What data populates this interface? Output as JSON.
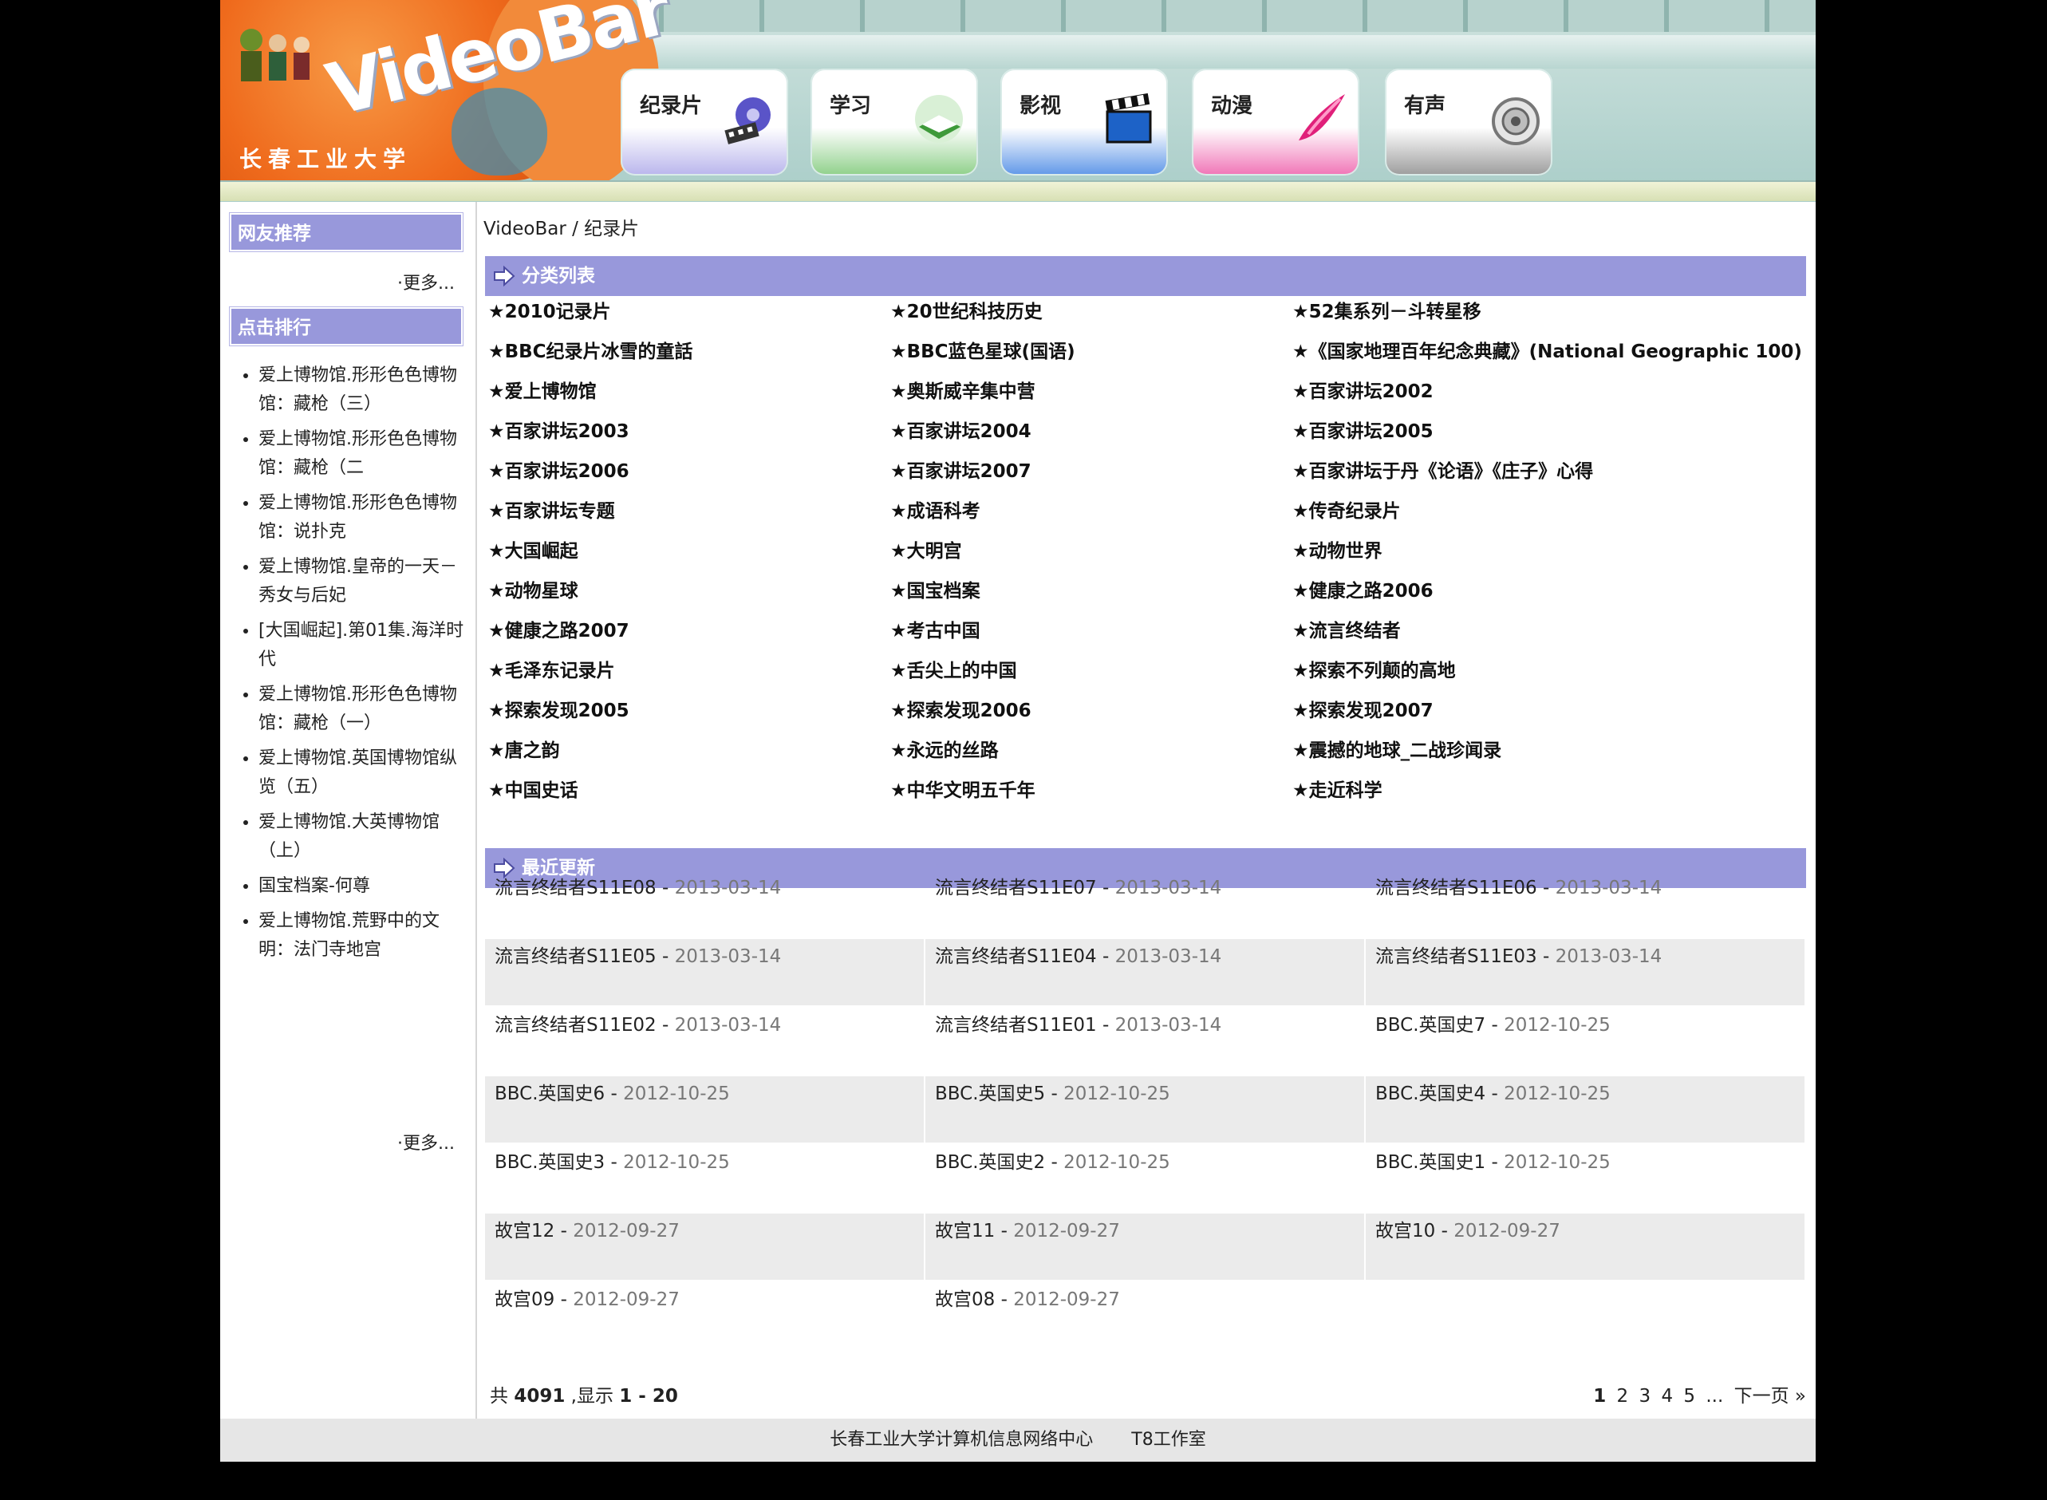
{
  "header": {
    "logo_title": "VideoBar",
    "logo_school": "长春工业大学",
    "nav": [
      {
        "label": "纪录片",
        "icon": "film-reel-icon"
      },
      {
        "label": "学习",
        "icon": "book-icon"
      },
      {
        "label": "影视",
        "icon": "clapperboard-icon"
      },
      {
        "label": "动漫",
        "icon": "brush-stroke-icon"
      },
      {
        "label": "有声",
        "icon": "speaker-icon"
      }
    ]
  },
  "sidebar": {
    "recommend_title": "网友推荐",
    "recommend_more": "·更多...",
    "rank_title": "点击排行",
    "rank_items": [
      "爱上博物馆.形形色色博物馆：藏枪（三）",
      "爱上博物馆.形形色色博物馆：藏枪（二",
      "爱上博物馆.形形色色博物馆：说扑克",
      "爱上博物馆.皇帝的一天－秀女与后妃",
      "[大国崛起].第01集.海洋时代",
      "爱上博物馆.形形色色博物馆：藏枪（一）",
      "爱上博物馆.英国博物馆纵览（五）",
      "爱上博物馆.大英博物馆（上）",
      "国宝档案-何尊",
      "爱上博物馆.荒野中的文明：法门寺地宫"
    ],
    "rank_more": "·更多..."
  },
  "main": {
    "breadcrumb_root": "VideoBar",
    "breadcrumb_sep": " / ",
    "breadcrumb_current": "纪录片",
    "category_title": "分类列表",
    "categories": [
      "★2010记录片",
      "★20世纪科技历史",
      "★52集系列－斗转星移",
      "★BBC纪录片冰雪的童話",
      "★BBC蓝色星球(国语)",
      "★《国家地理百年纪念典藏》(National Geographic 100)",
      "★爱上博物馆",
      "★奥斯威辛集中营",
      "★百家讲坛2002",
      "★百家讲坛2003",
      "★百家讲坛2004",
      "★百家讲坛2005",
      "★百家讲坛2006",
      "★百家讲坛2007",
      "★百家讲坛于丹《论语》《庄子》心得",
      "★百家讲坛专题",
      "★成语科考",
      "★传奇纪录片",
      "★大国崛起",
      "★大明宫",
      "★动物世界",
      "★动物星球",
      "★国宝档案",
      "★健康之路2006",
      "★健康之路2007",
      "★考古中国",
      "★流言终结者",
      "★毛泽东记录片",
      "★舌尖上的中国",
      "★探索不列颠的高地",
      "★探索发现2005",
      "★探索发现2006",
      "★探索发现2007",
      "★唐之韵",
      "★永远的丝路",
      "★震撼的地球_二战珍闻录",
      "★中国史话",
      "★中华文明五千年",
      "★走近科学"
    ],
    "updates_title": "最近更新",
    "updates": [
      {
        "title": "流言终结者S11E08",
        "date": "2013-03-14"
      },
      {
        "title": "流言终结者S11E07",
        "date": "2013-03-14"
      },
      {
        "title": "流言终结者S11E06",
        "date": "2013-03-14"
      },
      {
        "title": "流言终结者S11E05",
        "date": "2013-03-14"
      },
      {
        "title": "流言终结者S11E04",
        "date": "2013-03-14"
      },
      {
        "title": "流言终结者S11E03",
        "date": "2013-03-14"
      },
      {
        "title": "流言终结者S11E02",
        "date": "2013-03-14"
      },
      {
        "title": "流言终结者S11E01",
        "date": "2013-03-14"
      },
      {
        "title": "BBC.英国史7",
        "date": "2012-10-25"
      },
      {
        "title": "BBC.英国史6",
        "date": "2012-10-25"
      },
      {
        "title": "BBC.英国史5",
        "date": "2012-10-25"
      },
      {
        "title": "BBC.英国史4",
        "date": "2012-10-25"
      },
      {
        "title": "BBC.英国史3",
        "date": "2012-10-25"
      },
      {
        "title": "BBC.英国史2",
        "date": "2012-10-25"
      },
      {
        "title": "BBC.英国史1",
        "date": "2012-10-25"
      },
      {
        "title": "故宫12",
        "date": "2012-09-27"
      },
      {
        "title": "故宫11",
        "date": "2012-09-27"
      },
      {
        "title": "故宫10",
        "date": "2012-09-27"
      },
      {
        "title": "故宫09",
        "date": "2012-09-27"
      },
      {
        "title": "故宫08",
        "date": "2012-09-27"
      }
    ],
    "pager": {
      "total_prefix": "共 ",
      "total": "4091",
      "shown_prefix": " ,显示 ",
      "shown": "1 - 20",
      "pages": [
        "1",
        "2",
        "3",
        "4",
        "5"
      ],
      "ellipsis": "...",
      "next": "下一页 »"
    }
  },
  "footer": {
    "org": "长春工业大学计算机信息网络中心",
    "studio": "T8工作室"
  }
}
